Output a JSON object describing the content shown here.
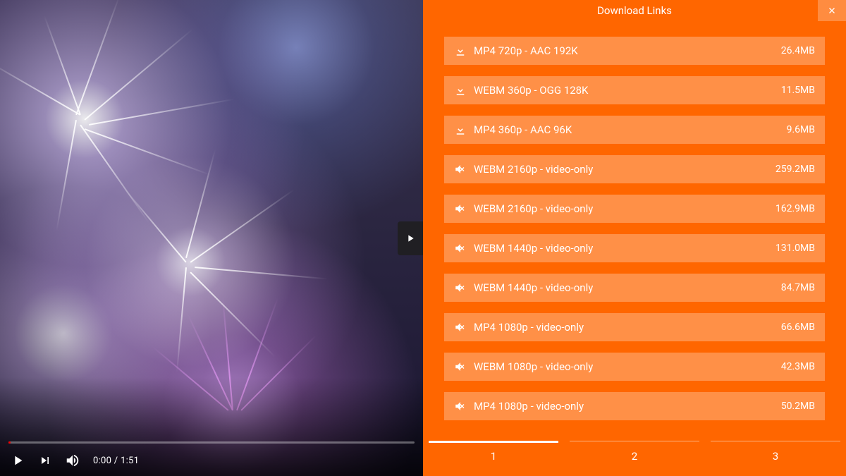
{
  "panel": {
    "title": "Download Links",
    "close_name": "close-icon"
  },
  "player": {
    "current_time": "0:00",
    "duration": "1:51",
    "time_display": "0:00 / 1:51",
    "progress_pct": 0.5
  },
  "downloads": [
    {
      "icon": "download-icon",
      "label": "MP4 720p - AAC 192K",
      "size": "26.4MB"
    },
    {
      "icon": "download-icon",
      "label": "WEBM 360p - OGG 128K",
      "size": "11.5MB"
    },
    {
      "icon": "download-icon",
      "label": "MP4 360p - AAC 96K",
      "size": "9.6MB"
    },
    {
      "icon": "muted-icon",
      "label": "WEBM 2160p - video-only",
      "size": "259.2MB"
    },
    {
      "icon": "muted-icon",
      "label": "WEBM 2160p - video-only",
      "size": "162.9MB"
    },
    {
      "icon": "muted-icon",
      "label": "WEBM 1440p - video-only",
      "size": "131.0MB"
    },
    {
      "icon": "muted-icon",
      "label": "WEBM 1440p - video-only",
      "size": "84.7MB"
    },
    {
      "icon": "muted-icon",
      "label": "MP4 1080p - video-only",
      "size": "66.6MB"
    },
    {
      "icon": "muted-icon",
      "label": "WEBM 1080p - video-only",
      "size": "42.3MB"
    },
    {
      "icon": "muted-icon",
      "label": "MP4 1080p - video-only",
      "size": "50.2MB"
    }
  ],
  "pager": {
    "pages": [
      "1",
      "2",
      "3"
    ],
    "active_index": 0
  }
}
